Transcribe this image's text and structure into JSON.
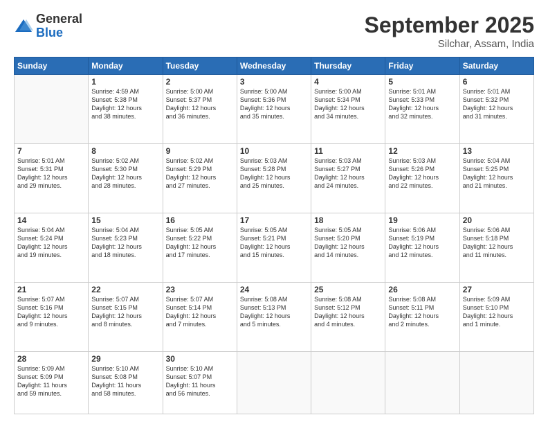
{
  "logo": {
    "general": "General",
    "blue": "Blue"
  },
  "header": {
    "title": "September 2025",
    "location": "Silchar, Assam, India"
  },
  "weekdays": [
    "Sunday",
    "Monday",
    "Tuesday",
    "Wednesday",
    "Thursday",
    "Friday",
    "Saturday"
  ],
  "weeks": [
    [
      {
        "day": "",
        "info": ""
      },
      {
        "day": "1",
        "info": "Sunrise: 4:59 AM\nSunset: 5:38 PM\nDaylight: 12 hours\nand 38 minutes."
      },
      {
        "day": "2",
        "info": "Sunrise: 5:00 AM\nSunset: 5:37 PM\nDaylight: 12 hours\nand 36 minutes."
      },
      {
        "day": "3",
        "info": "Sunrise: 5:00 AM\nSunset: 5:36 PM\nDaylight: 12 hours\nand 35 minutes."
      },
      {
        "day": "4",
        "info": "Sunrise: 5:00 AM\nSunset: 5:34 PM\nDaylight: 12 hours\nand 34 minutes."
      },
      {
        "day": "5",
        "info": "Sunrise: 5:01 AM\nSunset: 5:33 PM\nDaylight: 12 hours\nand 32 minutes."
      },
      {
        "day": "6",
        "info": "Sunrise: 5:01 AM\nSunset: 5:32 PM\nDaylight: 12 hours\nand 31 minutes."
      }
    ],
    [
      {
        "day": "7",
        "info": "Sunrise: 5:01 AM\nSunset: 5:31 PM\nDaylight: 12 hours\nand 29 minutes."
      },
      {
        "day": "8",
        "info": "Sunrise: 5:02 AM\nSunset: 5:30 PM\nDaylight: 12 hours\nand 28 minutes."
      },
      {
        "day": "9",
        "info": "Sunrise: 5:02 AM\nSunset: 5:29 PM\nDaylight: 12 hours\nand 27 minutes."
      },
      {
        "day": "10",
        "info": "Sunrise: 5:03 AM\nSunset: 5:28 PM\nDaylight: 12 hours\nand 25 minutes."
      },
      {
        "day": "11",
        "info": "Sunrise: 5:03 AM\nSunset: 5:27 PM\nDaylight: 12 hours\nand 24 minutes."
      },
      {
        "day": "12",
        "info": "Sunrise: 5:03 AM\nSunset: 5:26 PM\nDaylight: 12 hours\nand 22 minutes."
      },
      {
        "day": "13",
        "info": "Sunrise: 5:04 AM\nSunset: 5:25 PM\nDaylight: 12 hours\nand 21 minutes."
      }
    ],
    [
      {
        "day": "14",
        "info": "Sunrise: 5:04 AM\nSunset: 5:24 PM\nDaylight: 12 hours\nand 19 minutes."
      },
      {
        "day": "15",
        "info": "Sunrise: 5:04 AM\nSunset: 5:23 PM\nDaylight: 12 hours\nand 18 minutes."
      },
      {
        "day": "16",
        "info": "Sunrise: 5:05 AM\nSunset: 5:22 PM\nDaylight: 12 hours\nand 17 minutes."
      },
      {
        "day": "17",
        "info": "Sunrise: 5:05 AM\nSunset: 5:21 PM\nDaylight: 12 hours\nand 15 minutes."
      },
      {
        "day": "18",
        "info": "Sunrise: 5:05 AM\nSunset: 5:20 PM\nDaylight: 12 hours\nand 14 minutes."
      },
      {
        "day": "19",
        "info": "Sunrise: 5:06 AM\nSunset: 5:19 PM\nDaylight: 12 hours\nand 12 minutes."
      },
      {
        "day": "20",
        "info": "Sunrise: 5:06 AM\nSunset: 5:18 PM\nDaylight: 12 hours\nand 11 minutes."
      }
    ],
    [
      {
        "day": "21",
        "info": "Sunrise: 5:07 AM\nSunset: 5:16 PM\nDaylight: 12 hours\nand 9 minutes."
      },
      {
        "day": "22",
        "info": "Sunrise: 5:07 AM\nSunset: 5:15 PM\nDaylight: 12 hours\nand 8 minutes."
      },
      {
        "day": "23",
        "info": "Sunrise: 5:07 AM\nSunset: 5:14 PM\nDaylight: 12 hours\nand 7 minutes."
      },
      {
        "day": "24",
        "info": "Sunrise: 5:08 AM\nSunset: 5:13 PM\nDaylight: 12 hours\nand 5 minutes."
      },
      {
        "day": "25",
        "info": "Sunrise: 5:08 AM\nSunset: 5:12 PM\nDaylight: 12 hours\nand 4 minutes."
      },
      {
        "day": "26",
        "info": "Sunrise: 5:08 AM\nSunset: 5:11 PM\nDaylight: 12 hours\nand 2 minutes."
      },
      {
        "day": "27",
        "info": "Sunrise: 5:09 AM\nSunset: 5:10 PM\nDaylight: 12 hours\nand 1 minute."
      }
    ],
    [
      {
        "day": "28",
        "info": "Sunrise: 5:09 AM\nSunset: 5:09 PM\nDaylight: 11 hours\nand 59 minutes."
      },
      {
        "day": "29",
        "info": "Sunrise: 5:10 AM\nSunset: 5:08 PM\nDaylight: 11 hours\nand 58 minutes."
      },
      {
        "day": "30",
        "info": "Sunrise: 5:10 AM\nSunset: 5:07 PM\nDaylight: 11 hours\nand 56 minutes."
      },
      {
        "day": "",
        "info": ""
      },
      {
        "day": "",
        "info": ""
      },
      {
        "day": "",
        "info": ""
      },
      {
        "day": "",
        "info": ""
      }
    ]
  ]
}
